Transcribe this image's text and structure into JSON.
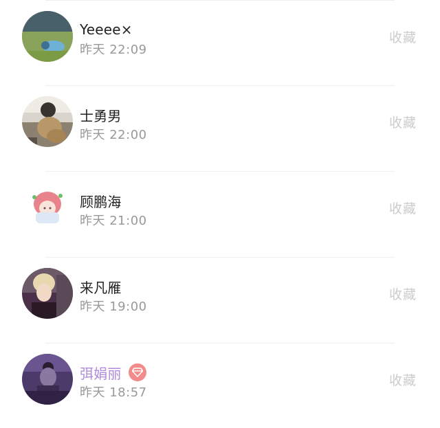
{
  "history": {
    "items": [
      {
        "name": "Yeeee×",
        "time": "昨天 22:09",
        "action": "收藏",
        "vip": false
      },
      {
        "name": "士勇男",
        "time": "昨天 22:00",
        "action": "收藏",
        "vip": false
      },
      {
        "name": "顾鹏海",
        "time": "昨天 21:00",
        "action": "收藏",
        "vip": false
      },
      {
        "name": "来凡雁",
        "time": "昨天 19:00",
        "action": "收藏",
        "vip": false
      },
      {
        "name": "弭娟丽",
        "time": "昨天 18:57",
        "action": "收藏",
        "vip": true,
        "badge_icon": "diamond-icon",
        "badge_color": "#f28b8b",
        "name_color": "#b08ad8"
      }
    ]
  },
  "colors": {
    "primary_text": "#222222",
    "secondary_text": "#999999",
    "action_text": "#cccccc",
    "divider": "#efefef"
  }
}
